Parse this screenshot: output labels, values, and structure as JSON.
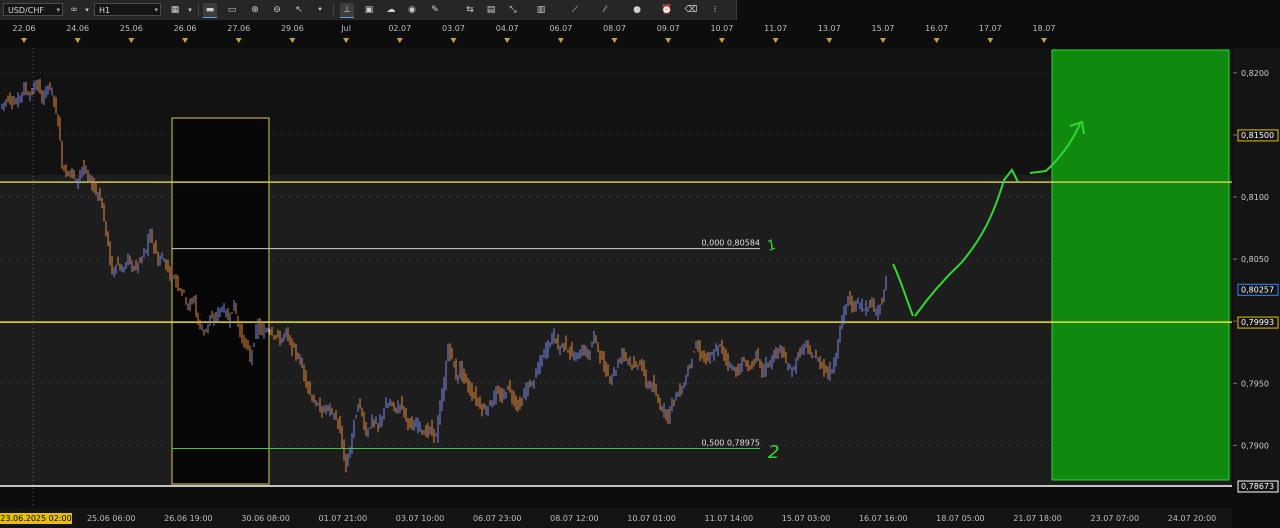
{
  "toolbar": {
    "symbol": "USD/CHF",
    "timeframe": "H1",
    "buttons": [
      "chart-type-icon",
      "line-tool-icon",
      "rectangle-tool-icon",
      "zoom-in-icon",
      "zoom-out-icon",
      "cursor-icon",
      "dot-icon",
      "vertical-line-icon",
      "note-icon",
      "cloud-icon",
      "globe-icon",
      "pencil-icon",
      "trades-icon",
      "table-icon",
      "arrows-icon",
      "grid-icon",
      "trend-icon",
      "circle-icon",
      "alarm-icon",
      "eraser-icon",
      "more-icon"
    ]
  },
  "chart_data": {
    "type": "candlestick",
    "symbol": "USD/CHF",
    "timeframe": "H1",
    "ylim": [
      0.78673,
      0.822
    ],
    "price_ticks": [
      "0,8200",
      "0,8150",
      "0,8100",
      "0,8050",
      "0,8000",
      "0,7950",
      "0,7900"
    ],
    "price_tick_values": [
      0.82,
      0.815,
      0.81,
      0.805,
      0.8,
      0.795,
      0.79
    ],
    "highlight_labels": [
      {
        "text": "0,81500",
        "value": 0.815,
        "color": "#e8c000"
      },
      {
        "text": "0,80257",
        "value": 0.80257,
        "color": "#2a8cff"
      },
      {
        "text": "0,79993",
        "value": 0.79993,
        "color": "#e8c000"
      },
      {
        "text": "0,78673",
        "value": 0.78673,
        "color": "#ffffff"
      }
    ],
    "top_dates": [
      "22.06",
      "24.06",
      "25.06",
      "26.06",
      "27.06",
      "29.06",
      "Jul",
      "02.07",
      "03.07",
      "04.07",
      "06.07",
      "08.07",
      "09.07",
      "10.07",
      "11.07",
      "13.07",
      "15.07",
      "16.07",
      "17.07",
      "18.07"
    ],
    "bottom_times": [
      "23.06.2025 02:00",
      "25.06 06:00",
      "26.06 19:00",
      "30.06 08:00",
      "01.07 21:00",
      "03.07 10:00",
      "06.07 23:00",
      "08.07 12:00",
      "10.07 01:00",
      "11.07 14:00",
      "15.07 03:00",
      "16.07 16:00",
      "18.07 05:00",
      "21.07 18:00",
      "23.07 07:00",
      "24.07 20:00"
    ],
    "horizontal_levels": [
      {
        "value": 0.8112,
        "color": "#d4c84a"
      },
      {
        "value": 0.79993,
        "color": "#e8e030"
      },
      {
        "value": 0.78673,
        "color": "#ffffff"
      }
    ],
    "fib_levels": [
      {
        "label": "0,000 0,80584",
        "value": 0.80584,
        "color": "#cfcfcf"
      },
      {
        "label": "0,500 0,78975",
        "value": 0.78975,
        "color": "#3fc83f"
      }
    ],
    "annotations": {
      "wave1": "1",
      "wave2": "2"
    },
    "price_path": [
      [
        0,
        0.8172
      ],
      [
        8,
        0.818
      ],
      [
        16,
        0.8176
      ],
      [
        24,
        0.8188
      ],
      [
        30,
        0.8182
      ],
      [
        36,
        0.8192
      ],
      [
        42,
        0.818
      ],
      [
        48,
        0.819
      ],
      [
        54,
        0.8178
      ],
      [
        58,
        0.816
      ],
      [
        62,
        0.8128
      ],
      [
        66,
        0.8118
      ],
      [
        70,
        0.8122
      ],
      [
        76,
        0.8112
      ],
      [
        82,
        0.8124
      ],
      [
        88,
        0.8115
      ],
      [
        94,
        0.8108
      ],
      [
        100,
        0.81
      ],
      [
        104,
        0.8082
      ],
      [
        108,
        0.806
      ],
      [
        112,
        0.8038
      ],
      [
        116,
        0.8048
      ],
      [
        122,
        0.804
      ],
      [
        128,
        0.805
      ],
      [
        134,
        0.8042
      ],
      [
        140,
        0.8048
      ],
      [
        146,
        0.8058
      ],
      [
        150,
        0.807
      ],
      [
        154,
        0.806
      ],
      [
        158,
        0.8048
      ],
      [
        162,
        0.8052
      ],
      [
        166,
        0.8045
      ],
      [
        172,
        0.8038
      ],
      [
        178,
        0.803
      ],
      [
        184,
        0.8022
      ],
      [
        188,
        0.8012
      ],
      [
        194,
        0.8018
      ],
      [
        198,
        0.7998
      ],
      [
        204,
        0.7992
      ],
      [
        210,
        0.8
      ],
      [
        216,
        0.8004
      ],
      [
        222,
        0.8012
      ],
      [
        228,
        0.8002
      ],
      [
        234,
        0.8014
      ],
      [
        240,
        0.799
      ],
      [
        246,
        0.798
      ],
      [
        250,
        0.797
      ],
      [
        254,
        0.7984
      ],
      [
        258,
        0.7998
      ],
      [
        262,
        0.799
      ],
      [
        268,
        0.7995
      ],
      [
        274,
        0.799
      ],
      [
        280,
        0.7985
      ],
      [
        286,
        0.799
      ],
      [
        292,
        0.7978
      ],
      [
        298,
        0.7972
      ],
      [
        304,
        0.7958
      ],
      [
        310,
        0.7942
      ],
      [
        316,
        0.7932
      ],
      [
        322,
        0.7928
      ],
      [
        328,
        0.793
      ],
      [
        334,
        0.7924
      ],
      [
        338,
        0.7918
      ],
      [
        342,
        0.79
      ],
      [
        346,
        0.7882
      ],
      [
        350,
        0.7898
      ],
      [
        354,
        0.7918
      ],
      [
        358,
        0.7934
      ],
      [
        362,
        0.7925
      ],
      [
        366,
        0.791
      ],
      [
        372,
        0.792
      ],
      [
        378,
        0.7914
      ],
      [
        384,
        0.793
      ],
      [
        390,
        0.7934
      ],
      [
        396,
        0.7928
      ],
      [
        400,
        0.7935
      ],
      [
        406,
        0.7922
      ],
      [
        412,
        0.7914
      ],
      [
        418,
        0.7918
      ],
      [
        424,
        0.791
      ],
      [
        430,
        0.7912
      ],
      [
        436,
        0.7908
      ],
      [
        440,
        0.793
      ],
      [
        444,
        0.795
      ],
      [
        448,
        0.798
      ],
      [
        452,
        0.797
      ],
      [
        456,
        0.7955
      ],
      [
        460,
        0.7962
      ],
      [
        466,
        0.795
      ],
      [
        472,
        0.7942
      ],
      [
        478,
        0.7935
      ],
      [
        484,
        0.7928
      ],
      [
        490,
        0.7934
      ],
      [
        496,
        0.7942
      ],
      [
        502,
        0.7938
      ],
      [
        508,
        0.7948
      ],
      [
        514,
        0.7936
      ],
      [
        520,
        0.7932
      ],
      [
        526,
        0.7946
      ],
      [
        532,
        0.795
      ],
      [
        538,
        0.7962
      ],
      [
        544,
        0.7975
      ],
      [
        550,
        0.7984
      ],
      [
        554,
        0.799
      ],
      [
        558,
        0.7978
      ],
      [
        564,
        0.7982
      ],
      [
        570,
        0.7975
      ],
      [
        576,
        0.797
      ],
      [
        582,
        0.7978
      ],
      [
        588,
        0.7972
      ],
      [
        594,
        0.7988
      ],
      [
        598,
        0.7978
      ],
      [
        604,
        0.7962
      ],
      [
        610,
        0.7955
      ],
      [
        616,
        0.7962
      ],
      [
        622,
        0.7975
      ],
      [
        628,
        0.797
      ],
      [
        634,
        0.7962
      ],
      [
        640,
        0.7968
      ],
      [
        646,
        0.795
      ],
      [
        652,
        0.7948
      ],
      [
        658,
        0.7935
      ],
      [
        664,
        0.7928
      ],
      [
        668,
        0.7924
      ],
      [
        672,
        0.7935
      ],
      [
        678,
        0.7942
      ],
      [
        684,
        0.795
      ],
      [
        690,
        0.7968
      ],
      [
        696,
        0.798
      ],
      [
        702,
        0.7972
      ],
      [
        708,
        0.7968
      ],
      [
        714,
        0.7975
      ],
      [
        720,
        0.798
      ],
      [
        726,
        0.797
      ],
      [
        732,
        0.7962
      ],
      [
        738,
        0.796
      ],
      [
        744,
        0.7968
      ],
      [
        750,
        0.7962
      ],
      [
        756,
        0.7972
      ],
      [
        762,
        0.796
      ],
      [
        768,
        0.7966
      ],
      [
        774,
        0.7972
      ],
      [
        780,
        0.7978
      ],
      [
        786,
        0.7966
      ],
      [
        792,
        0.796
      ],
      [
        798,
        0.7972
      ],
      [
        804,
        0.798
      ],
      [
        810,
        0.7974
      ],
      [
        816,
        0.797
      ],
      [
        822,
        0.7965
      ],
      [
        828,
        0.7958
      ],
      [
        832,
        0.7962
      ],
      [
        836,
        0.7975
      ],
      [
        840,
        0.7995
      ],
      [
        844,
        0.8008
      ],
      [
        848,
        0.8018
      ],
      [
        852,
        0.8012
      ],
      [
        858,
        0.8015
      ],
      [
        864,
        0.801
      ],
      [
        870,
        0.8016
      ],
      [
        876,
        0.8008
      ],
      [
        880,
        0.8014
      ],
      [
        884,
        0.8022
      ],
      [
        887,
        0.804
      ]
    ]
  }
}
